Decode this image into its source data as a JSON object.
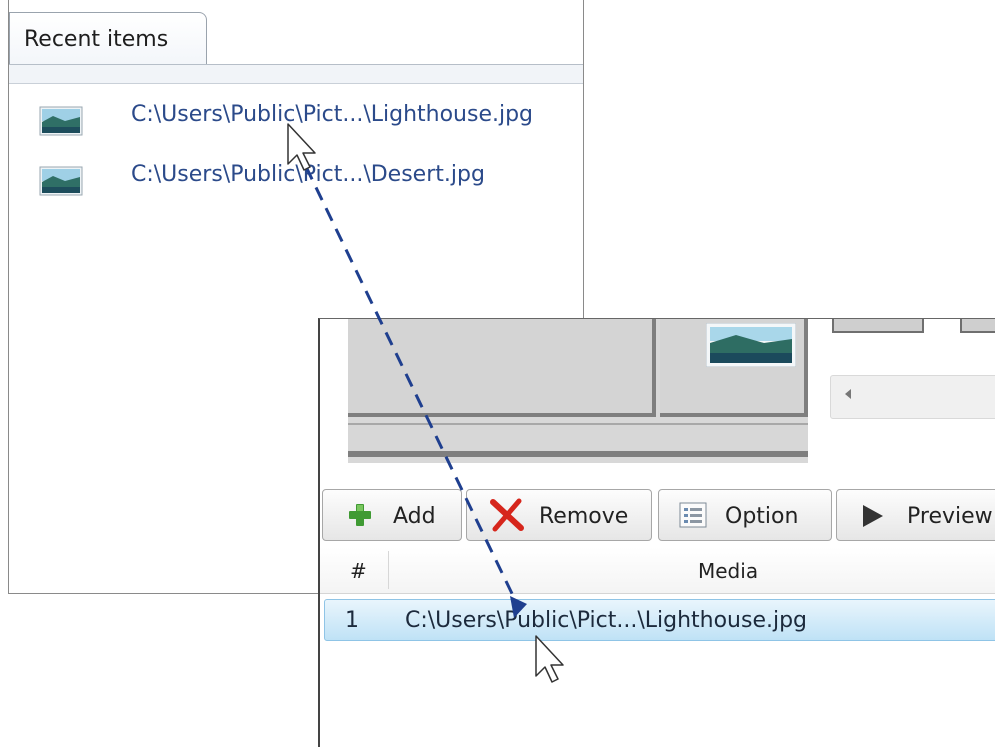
{
  "recent_panel": {
    "tab_label": "Recent items",
    "items": [
      {
        "path": "C:\\Users\\Public\\Pict...\\Lighthouse.jpg",
        "icon": "image-file-icon"
      },
      {
        "path": "C:\\Users\\Public\\Pict...\\Desert.jpg",
        "icon": "image-file-icon"
      }
    ]
  },
  "media_window": {
    "toolbar": {
      "add_label": "Add",
      "remove_label": "Remove",
      "option_label": "Option",
      "preview_label": "Preview"
    },
    "grid": {
      "columns": [
        "#",
        "Media"
      ],
      "rows": [
        {
          "number": "1",
          "path": "C:\\Users\\Public\\Pict...\\Lighthouse.jpg"
        }
      ]
    }
  },
  "colors": {
    "accent_arrow": "#1f3f8f",
    "selection": "#bfe2f6",
    "link_text": "#2b4a8a"
  }
}
